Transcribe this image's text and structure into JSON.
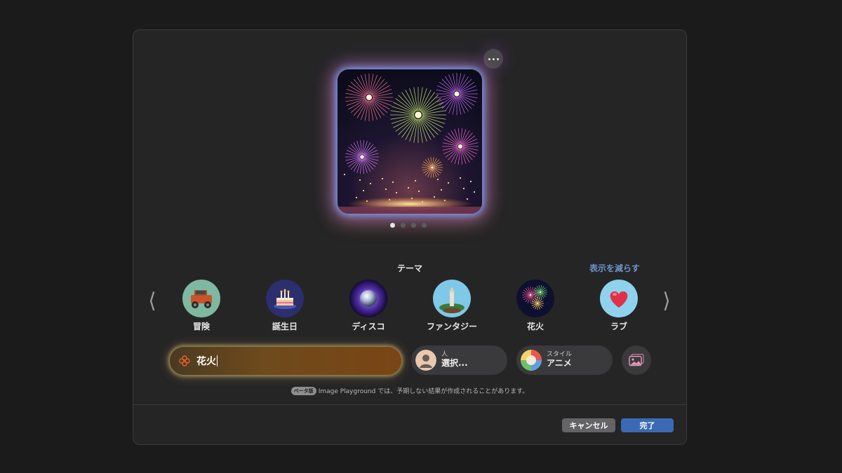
{
  "preview": {
    "page_count": 4,
    "active_page": 1
  },
  "themes": {
    "title": "テーマ",
    "show_less": "表示を減らす",
    "items": [
      {
        "label": "冒険",
        "icon": "jeep-icon"
      },
      {
        "label": "誕生日",
        "icon": "birthday-cake-icon"
      },
      {
        "label": "ディスコ",
        "icon": "disco-ball-icon"
      },
      {
        "label": "ファンタジー",
        "icon": "fantasy-island-icon"
      },
      {
        "label": "花火",
        "icon": "fireworks-icon"
      },
      {
        "label": "ラブ",
        "icon": "heart-icon"
      }
    ]
  },
  "prompt": {
    "value": "花火"
  },
  "person": {
    "caption": "人",
    "value": "選択..."
  },
  "style": {
    "caption": "スタイル",
    "value": "アニメ"
  },
  "disclaimer": {
    "badge": "ベータ版",
    "text": "Image Playground では、予期しない結果が作成されることがあります。"
  },
  "buttons": {
    "cancel": "キャンセル",
    "done": "完了"
  },
  "colors": {
    "accent": "#3a6ab3",
    "link": "#6d95c8",
    "background": "#252526"
  }
}
